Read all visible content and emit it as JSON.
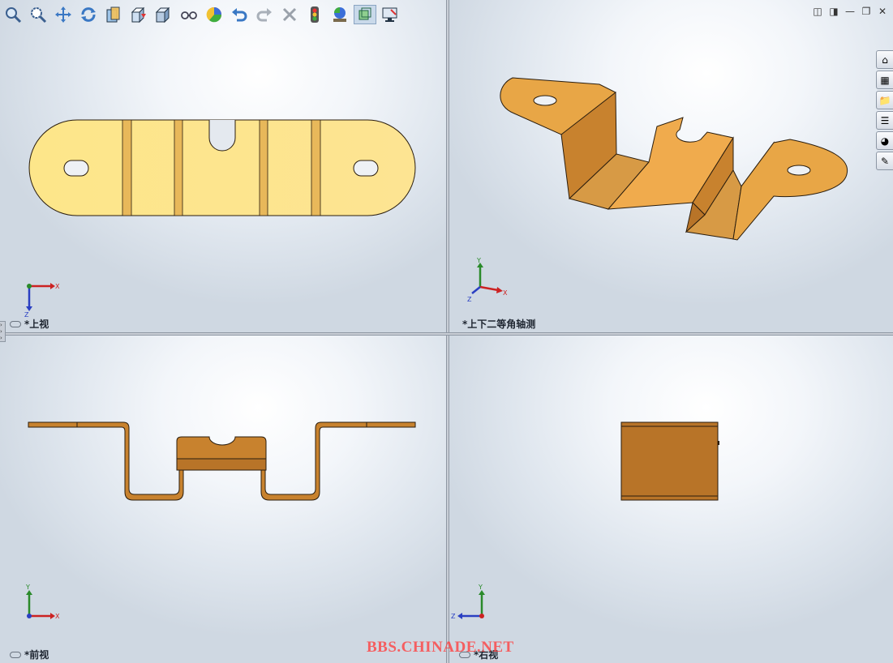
{
  "toolbar": {
    "items": [
      {
        "name": "zoom-to-fit",
        "glyph": "🔍"
      },
      {
        "name": "zoom-to-area",
        "glyph": "🔍"
      },
      {
        "name": "pan",
        "glyph": "✥"
      },
      {
        "name": "rotate",
        "glyph": "⟳"
      },
      {
        "name": "section-view",
        "glyph": "▥"
      },
      {
        "name": "view-orientation",
        "glyph": "⬚"
      },
      {
        "name": "display-style",
        "glyph": "◧"
      },
      {
        "name": "hide-show-items",
        "glyph": "👓"
      },
      {
        "name": "appearance",
        "glyph": "●"
      },
      {
        "name": "undo",
        "glyph": "↶"
      },
      {
        "name": "redo",
        "glyph": "↷"
      },
      {
        "name": "delete",
        "glyph": "✕"
      },
      {
        "name": "traffic-light",
        "glyph": "▮"
      },
      {
        "name": "scene",
        "glyph": "◕"
      },
      {
        "name": "view-settings",
        "glyph": "▣"
      },
      {
        "name": "render",
        "glyph": "🖥"
      }
    ]
  },
  "window_controls": [
    "◫",
    "◨",
    "—",
    "❐",
    "✕"
  ],
  "viewports": {
    "top_left": {
      "label": "*上视",
      "triad": {
        "axis1": "X",
        "axis2": "Z"
      }
    },
    "top_right": {
      "label": "*上下二等角轴测",
      "triad": {
        "axis1": "Y",
        "axis2": "X",
        "axis3": "Z"
      }
    },
    "bottom_left": {
      "label": "*前视",
      "triad": {
        "axis1": "Y",
        "axis2": "X"
      }
    },
    "bottom_right": {
      "label": "*右视",
      "triad": {
        "axis1": "Y",
        "axis2": "Z"
      }
    }
  },
  "task_pane": [
    "⌂",
    "▦",
    "📁",
    "☰",
    "◕",
    "✎"
  ],
  "watermark": "BBS.CHINADE.NET",
  "colors": {
    "part_top": "#fde68a",
    "part_iso": "#e8a646",
    "part_side": "#b8752a",
    "edge": "#2a1d0e"
  }
}
